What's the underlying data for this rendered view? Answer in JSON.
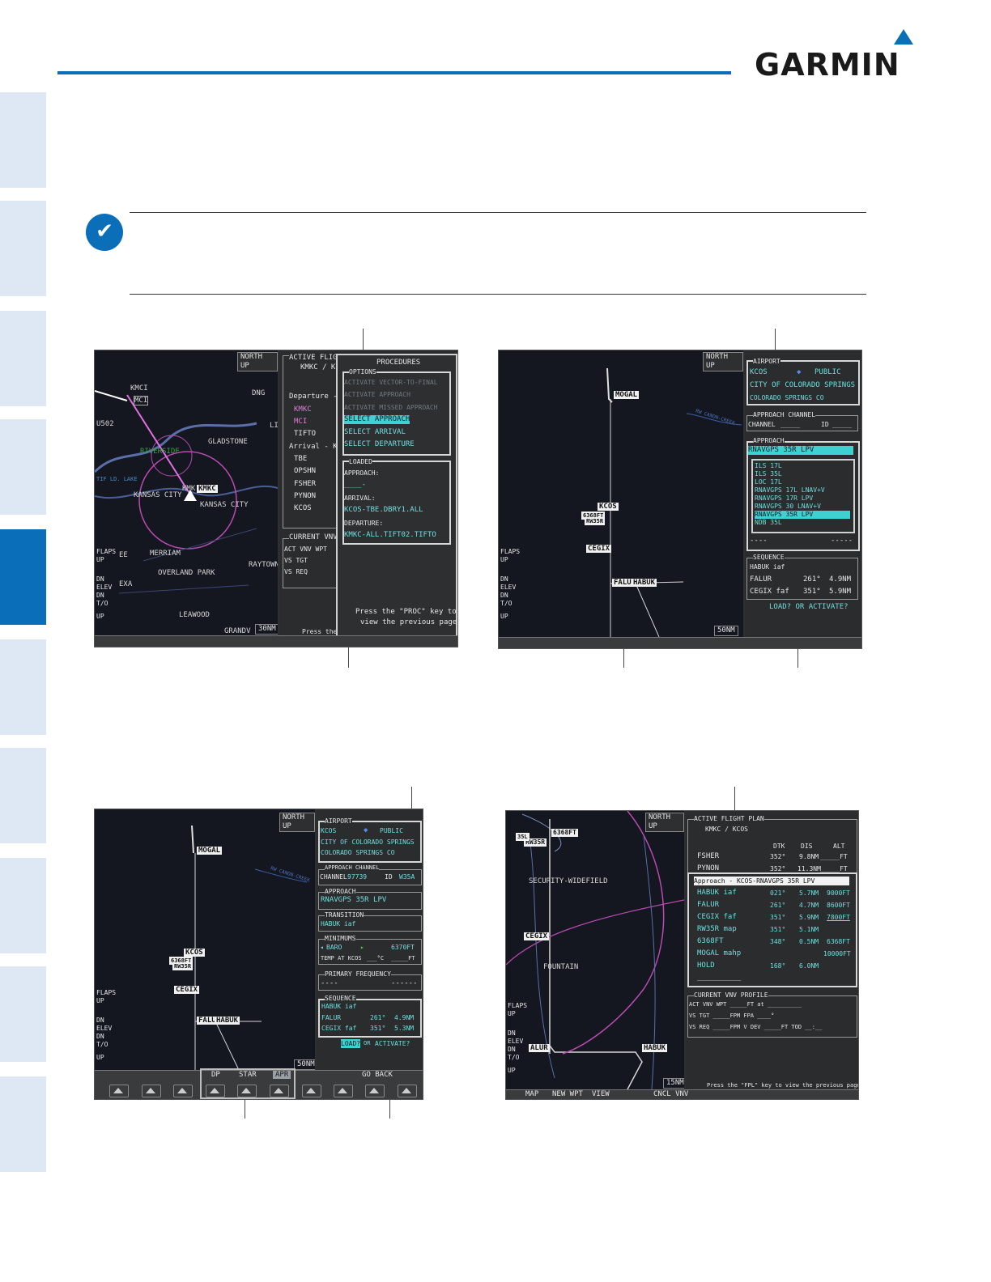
{
  "header": {
    "logo": "GARMIN"
  },
  "note": {
    "icon": "checkmark-note-icon"
  },
  "screens": {
    "s1": {
      "north_up": "NORTH UP",
      "range": "30NM",
      "active_fp_title": "ACTIVE FLIGHT",
      "active_fp_route": "KMKC / KC",
      "departure_line": "Departure - K",
      "fp_wpts": [
        "KMKC",
        "MCI",
        "TIFTO"
      ],
      "arrival_line": "Arrival - KCO",
      "arr_wpts": [
        "TBE",
        "OPSHN",
        "FSHER",
        "PYNON",
        "KCOS"
      ],
      "vnv_title": "CURRENT VNV P",
      "vnv_rows": [
        "ACT VNV WPT",
        "VS TGT",
        "VS REQ"
      ],
      "proc_title": "PROCEDURES",
      "options_title": "OPTIONS",
      "options": [
        "ACTIVATE VECTOR-TO-FINAL",
        "ACTIVATE APPROACH",
        "ACTIVATE MISSED APPROACH",
        "SELECT APPROACH",
        "SELECT ARRIVAL",
        "SELECT DEPARTURE"
      ],
      "loaded_title": "LOADED",
      "loaded": [
        "APPROACH:",
        "____-",
        "ARRIVAL:",
        "KCOS-TBE.DBRY1.ALL",
        "DEPARTURE:",
        "KMKC-ALL.TIFT02.TIFTO"
      ],
      "proc_footer": [
        "Press the \"PROC\" key to",
        "view the previous page"
      ],
      "footer_cut": "Press the \"F",
      "map_labels": [
        "KMCI",
        "MCI",
        "DNG",
        "U502",
        "GLADSTONE",
        "RIVERSIDE",
        "TIF LD. LAKE",
        "KANSAS CITY",
        "KMK",
        "KMKC",
        "KANSAS CITY",
        "MERRIAM",
        "OVERLAND PARK",
        "RAYTOWN",
        "LEAWOOD",
        "GRANDV",
        "EXA",
        "EE",
        "LI"
      ],
      "flaps": [
        "FLAPS",
        "UP",
        "DN",
        "ELEV",
        "DN",
        "T/O",
        "UP"
      ]
    },
    "s2": {
      "north_up": "NORTH UP",
      "range": "50NM",
      "airport_title": "AIRPORT",
      "airport_id": "KCOS",
      "airport_type": "PUBLIC",
      "airport_city": "CITY OF COLORADO SPRINGS",
      "airport_loc": "COLORADO SPRINGS CO",
      "channel_title": "APPROACH CHANNEL",
      "channel_label": "CHANNEL",
      "channel_val": "_____",
      "id_label": "ID",
      "id_val": "_____",
      "approach_title": "APPROACH",
      "approach_sel": "RNAVGPS 35R LPV",
      "approach_list": [
        "ILS 17L",
        "ILS 35L",
        "LOC 17L",
        "RNAVGPS 17L LNAV+V",
        "RNAVGPS 17R LPV",
        "RNAVGPS 30 LNAV+V",
        "RNAVGPS 35R LPV",
        "NDB 35L"
      ],
      "dashes_left": "----",
      "dashes_right": "-----",
      "sequence_title": "SEQUENCE",
      "sequence": [
        {
          "wpt": "HABUK iaf",
          "dtk": "",
          "dis": ""
        },
        {
          "wpt": "FALUR",
          "dtk": "261°",
          "dis": "4.9NM"
        },
        {
          "wpt": "CEGIX faf",
          "dtk": "351°",
          "dis": "5.9NM"
        }
      ],
      "load_prompt": "LOAD? OR ACTIVATE?",
      "map_labels": [
        "MOGAL",
        "KCOS",
        "6368FT",
        "RW35R",
        "CEGIX",
        "FALUR",
        "HABUK",
        "RW CANON-CREEK"
      ],
      "flaps": [
        "FLAPS",
        "UP",
        "DN",
        "ELEV",
        "DN",
        "T/O",
        "UP"
      ]
    },
    "s3": {
      "north_up": "NORTH UP",
      "range": "50NM",
      "airport_title": "AIRPORT",
      "airport_id": "KCOS",
      "airport_type": "PUBLIC",
      "airport_city": "CITY OF COLORADO SPRINGS",
      "airport_loc": "COLORADO SPRINGS CO",
      "channel_title": "APPROACH CHANNEL",
      "channel_label": "CHANNEL",
      "channel_val": "97739",
      "id_label": "ID",
      "id_val": "W35A",
      "approach_title": "APPROACH",
      "approach_val": "RNAVGPS 35R LPV",
      "transition_title": "TRANSITION",
      "transition_val": "HABUK iaf",
      "minimums_title": "MINIMUMS",
      "minimums_baro": "BARO",
      "minimums_val": "6370FT",
      "temp_label": "TEMP AT KCOS",
      "temp_val": "___°C",
      "temp_ft": "_____FT",
      "freq_title": "PRIMARY FREQUENCY",
      "freq_left": "----",
      "freq_right": "------",
      "sequence_title": "SEQUENCE",
      "sequence": [
        {
          "wpt": "HABUK iaf",
          "dtk": "",
          "dis": ""
        },
        {
          "wpt": "FALUR",
          "dtk": "261°",
          "dis": "4.9NM"
        },
        {
          "wpt": "CEGIX faf",
          "dtk": "351°",
          "dis": "5.3NM"
        }
      ],
      "load_btn": "LOAD?",
      "load_or": "OR",
      "activate": "ACTIVATE?",
      "softkeys": [
        "DP",
        "STAR",
        "APR",
        "GO BACK"
      ],
      "map_labels": [
        "MOGAL",
        "KCOS",
        "6368FT",
        "RW35R",
        "CEGIX",
        "FALUR",
        "HABUK",
        "RW CANON-CREEK"
      ],
      "flaps": [
        "FLAPS",
        "UP",
        "DN",
        "ELEV",
        "DN",
        "T/O",
        "UP"
      ]
    },
    "s4": {
      "north_up": "NORTH UP",
      "range": "15NM",
      "afp_title": "ACTIVE FLIGHT PLAN",
      "afp_route": "KMKC / KCOS",
      "cols": [
        "DTK",
        "DIS",
        "ALT"
      ],
      "pre_rows": [
        {
          "wpt": "FSHER",
          "dtk": "352°",
          "dis": "9.8NM",
          "alt": "_____FT"
        },
        {
          "wpt": "PYNON",
          "dtk": "352°",
          "dis": "11.3NM",
          "alt": "_____FT"
        }
      ],
      "approach_header": "Approach - KCOS-RNAVGPS 35R LPV",
      "rows": [
        {
          "wpt": "HABUK iaf",
          "dtk": "021°",
          "dis": "5.7NM",
          "alt": "9000FT"
        },
        {
          "wpt": "FALUR",
          "dtk": "261°",
          "dis": "4.7NM",
          "alt": "8600FT"
        },
        {
          "wpt": "CEGIX faf",
          "dtk": "351°",
          "dis": "5.9NM",
          "alt": "7800FT"
        },
        {
          "wpt": "RW35R map",
          "dtk": "351°",
          "dis": "5.1NM",
          "alt": ""
        },
        {
          "wpt": "6368FT",
          "dtk": "348°",
          "dis": "0.5NM",
          "alt": "6368FT"
        },
        {
          "wpt": "MOGAL mahp",
          "dtk": "",
          "dis": "",
          "alt": "10000FT"
        },
        {
          "wpt": "HOLD",
          "dtk": "168°",
          "dis": "6.0NM",
          "alt": ""
        }
      ],
      "end_dashes": "__________",
      "vnv_title": "CURRENT VNV PROFILE",
      "vnv_rows": [
        "ACT VNV WPT   _____FT at  __________",
        "VS TGT   _____FPM   FPA    ____°",
        "VS REQ   _____FPM   V DEV  _____FT   TOD  __:__"
      ],
      "footer": "Press the \"FPL\" key to view the previous page",
      "softkeys": [
        "MAP",
        "NEW WPT",
        "VIEW",
        "CNCL VNV"
      ],
      "map_labels": [
        "6368FT",
        "RW35R",
        "35L",
        "SECURITY-WIDEFIELD",
        "CEGIX",
        "FOUNTAIN",
        "ALUR",
        "HABUK"
      ],
      "flaps": [
        "FLAPS",
        "UP",
        "DN",
        "ELEV",
        "DN",
        "T/O",
        "UP"
      ]
    }
  }
}
